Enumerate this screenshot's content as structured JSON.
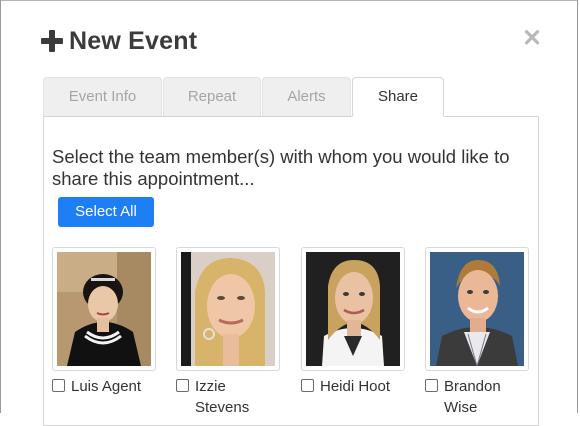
{
  "dialog": {
    "title": "New Event"
  },
  "tabs": [
    {
      "label": "Event Info"
    },
    {
      "label": "Repeat"
    },
    {
      "label": "Alerts"
    },
    {
      "label": "Share"
    }
  ],
  "share": {
    "prompt": "Select the team member(s) with whom you would like to share this appointment...",
    "select_all_label": "Select All",
    "members": [
      {
        "name_line1": "Luis Agent",
        "name_line2": "",
        "checked": false
      },
      {
        "name_line1": "Izzie",
        "name_line2": "Stevens",
        "checked": false
      },
      {
        "name_line1": "Heidi Hoot",
        "name_line2": "",
        "checked": false
      },
      {
        "name_line1": "Brandon",
        "name_line2": "Wise",
        "checked": false
      }
    ]
  },
  "icons": {
    "add": "plus-icon",
    "close": "close-icon"
  },
  "colors": {
    "accent": "#1e7ff5"
  }
}
